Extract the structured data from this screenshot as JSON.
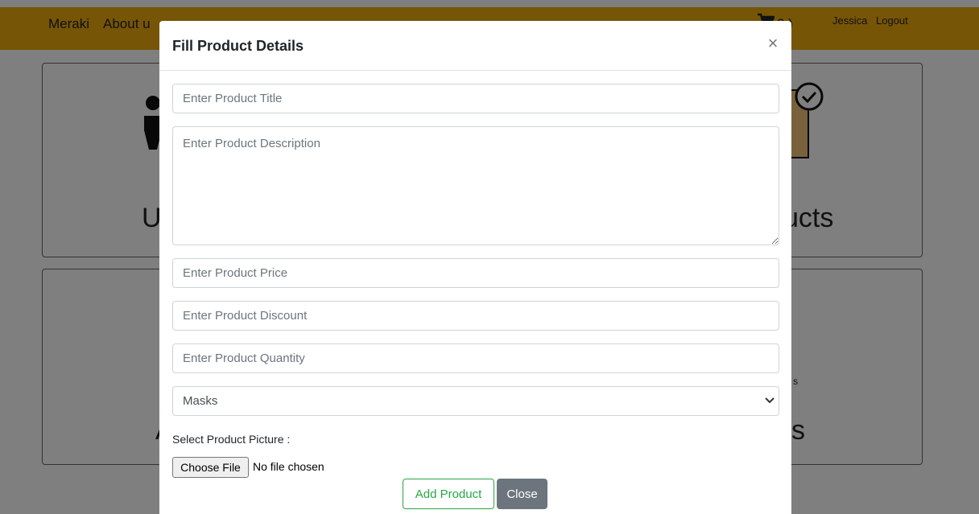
{
  "navbar": {
    "brand": "Meraki",
    "about": "About u",
    "cart_count": "0 )",
    "user": "Jessica",
    "logout": "Logout",
    "color": "#edaa0c"
  },
  "cards": {
    "card1_left_heading": "U",
    "card1_right_heading": "ucts",
    "card2_left_heading": "A",
    "card2_right_heading": "s",
    "card2_right_sub": "s"
  },
  "modal": {
    "title": "Fill Product Details",
    "close_symbol": "×",
    "title_placeholder": "Enter Product Title",
    "description_placeholder": "Enter Product Description",
    "price_placeholder": "Enter Product Price",
    "discount_placeholder": "Enter Product Discount",
    "quantity_placeholder": "Enter Product Quantity",
    "category_selected": "Masks",
    "picture_label": "Select Product Picture :",
    "file_button": "Choose File",
    "file_status": "No file chosen",
    "add_button": "Add Product",
    "close_button": "Close",
    "accent_green": "#28a745",
    "secondary_gray": "#6c757d"
  }
}
